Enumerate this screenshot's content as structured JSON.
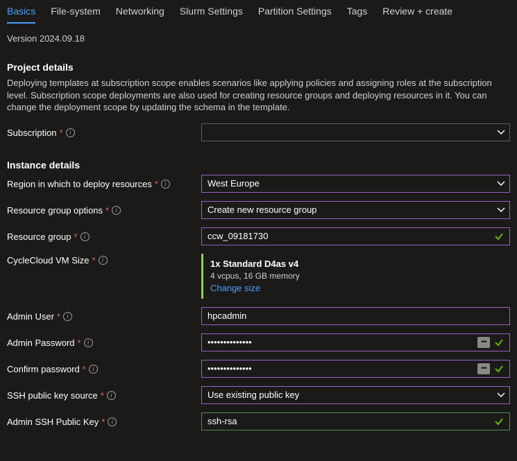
{
  "tabs": {
    "basics": "Basics",
    "filesystem": "File-system",
    "networking": "Networking",
    "slurm": "Slurm Settings",
    "partition": "Partition Settings",
    "tags": "Tags",
    "review": "Review + create"
  },
  "version": "Version 2024.09.18",
  "project": {
    "title": "Project details",
    "desc": "Deploying templates at subscription scope enables scenarios like applying policies and assigning roles at the subscription level. Subscription scope deployments are also used for creating resource groups and deploying resources in it. You can change the deployment scope by updating the schema in the template.",
    "subscription_label": "Subscription",
    "subscription_value": ""
  },
  "instance": {
    "title": "Instance details",
    "region_label": "Region in which to deploy resources",
    "region_value": "West Europe",
    "rg_options_label": "Resource group options",
    "rg_options_value": "Create new resource group",
    "rg_label": "Resource group",
    "rg_value": "ccw_09181730",
    "vmsize_label": "CycleCloud VM Size",
    "vmsize_title": "1x Standard D4as v4",
    "vmsize_sub": "4 vcpus, 16 GB memory",
    "vmsize_change": "Change size",
    "admin_user_label": "Admin User",
    "admin_user_value": "hpcadmin",
    "admin_pw_label": "Admin Password",
    "admin_pw_value": "••••••••••••••",
    "confirm_pw_label": "Confirm password",
    "confirm_pw_value": "••••••••••••••",
    "ssh_source_label": "SSH public key source",
    "ssh_source_value": "Use existing public key",
    "ssh_key_label": "Admin SSH Public Key",
    "ssh_key_value": "ssh-rsa"
  }
}
